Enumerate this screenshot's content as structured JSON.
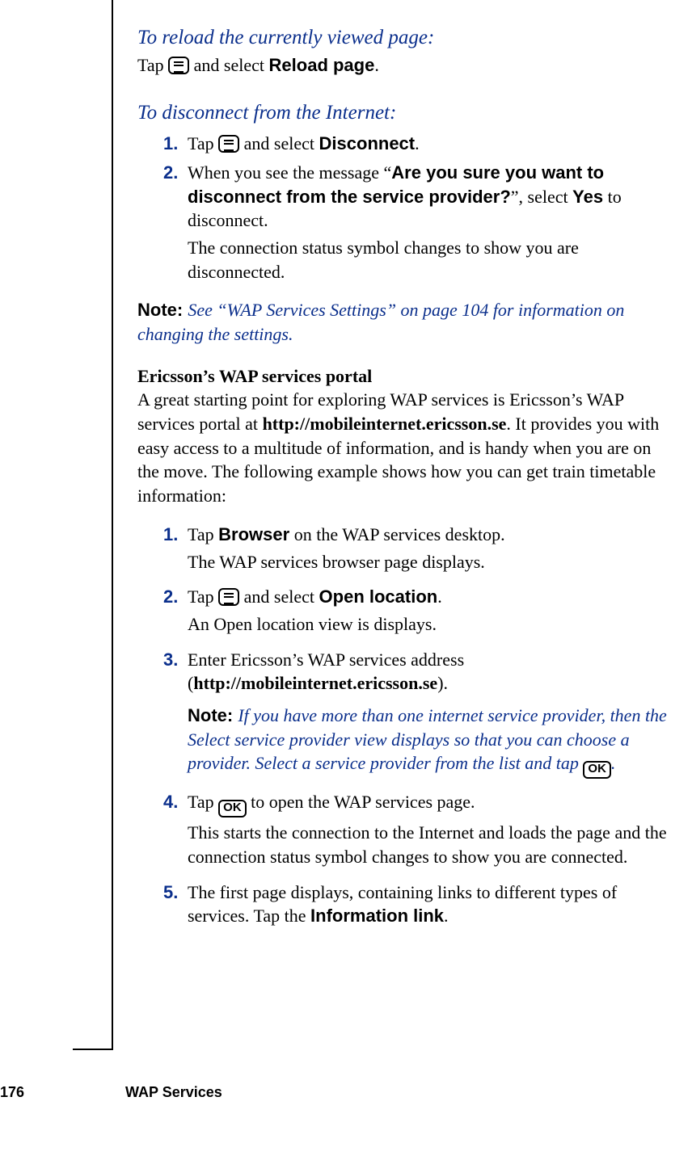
{
  "footer": {
    "page_number": "176",
    "section": "WAP Services"
  },
  "section_reload": {
    "heading": "To reload the currently viewed page:",
    "line_pre": "Tap ",
    "line_post": " and select ",
    "bold": "Reload page",
    "tail": "."
  },
  "section_disconnect": {
    "heading": "To disconnect from the Internet:",
    "items": [
      {
        "num": "1.",
        "pre": "Tap ",
        "mid": " and select ",
        "bold": "Disconnect",
        "tail": "."
      },
      {
        "num": "2.",
        "pre": "When you see the message “",
        "bold": "Are you sure you want to disconnect from the service provider?",
        "mid": "”, select ",
        "bold2": "Yes",
        "tail": " to disconnect.",
        "cont": "The connection status symbol changes to show you are disconnected."
      }
    ]
  },
  "note1": {
    "label": "Note:  ",
    "text": "See “WAP Services Settings” on page 104 for information on changing the settings."
  },
  "portal": {
    "subhead": "Ericsson’s WAP services portal",
    "para_pre": "A great starting point for exploring WAP services is Ericsson’s WAP services portal at ",
    "url": "http://mobileinternet.ericsson.se",
    "para_post": ". It provides you with easy access to a multitude of information, and is handy when you are on the move. The following example shows how you can get train timetable information:"
  },
  "steps": [
    {
      "num": "1.",
      "pre": "Tap ",
      "bold": "Browser",
      "post": " on the WAP services desktop.",
      "cont": "The WAP services browser page displays."
    },
    {
      "num": "2.",
      "pre": "Tap ",
      "mid": " and select ",
      "bold": "Open location",
      "post": ".",
      "cont": "An Open location view is displays."
    },
    {
      "num": "3.",
      "pre": "Enter Ericsson’s WAP services address (",
      "url": "http://mobileinternet.ericsson.se",
      "post": ").",
      "note_label": "Note:  ",
      "note_text_a": "If you have more than one internet service provider, then the Select service provider view displays so that you can choose a provider. Select a service provider from the list and tap ",
      "note_tail": "."
    },
    {
      "num": "4.",
      "pre": "Tap ",
      "post": " to open the WAP services page.",
      "cont": "This starts the connection to the Internet and loads the page and the connection status symbol changes to show you are connected."
    },
    {
      "num": "5.",
      "pre": "The first page displays, containing links to different types of services. Tap the ",
      "bold": "Information link",
      "post": "."
    }
  ],
  "icons": {
    "ok_label": "OK"
  }
}
